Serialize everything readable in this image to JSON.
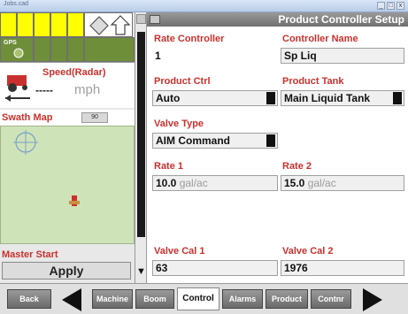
{
  "window": {
    "title": "Jobs.cad",
    "controls": [
      "_",
      "□",
      "x"
    ]
  },
  "left_panel": {
    "gps_label": "GPS",
    "speed": {
      "title": "Speed(Radar)",
      "value": "-----",
      "unit": "mph"
    },
    "swath_map": {
      "title": "Swath Map",
      "badge": "90"
    },
    "master_start": {
      "label": "Master Start",
      "button": "Apply"
    }
  },
  "right_panel": {
    "title": "Product Controller Setup",
    "fields": {
      "rate_controller": {
        "label": "Rate Controller",
        "value": "1"
      },
      "controller_name": {
        "label": "Controller Name",
        "value": "Sp Liq"
      },
      "product_ctrl": {
        "label": "Product Ctrl",
        "value": "Auto"
      },
      "product_tank": {
        "label": "Product Tank",
        "value": "Main Liquid Tank"
      },
      "valve_type": {
        "label": "Valve Type",
        "value": "AIM Command"
      },
      "rate1": {
        "label": "Rate 1",
        "value": "10.0",
        "unit": "gal/ac"
      },
      "rate2": {
        "label": "Rate 2",
        "value": "15.0",
        "unit": "gal/ac"
      },
      "valve_cal1": {
        "label": "Valve Cal 1",
        "value": "63"
      },
      "valve_cal2": {
        "label": "Valve Cal 2",
        "value": "1976"
      }
    }
  },
  "tabs": {
    "back": "Back",
    "machine": "Machine",
    "boom": "Boom",
    "control": "Control",
    "alarms": "Alarms",
    "product": "Product",
    "contnr": "Contnr"
  },
  "colors": {
    "label_red": "#c8312e",
    "grid_yellow": "#ffff00",
    "grid_green": "#6e8e3a",
    "tab_grey": "#7a7a7a"
  }
}
